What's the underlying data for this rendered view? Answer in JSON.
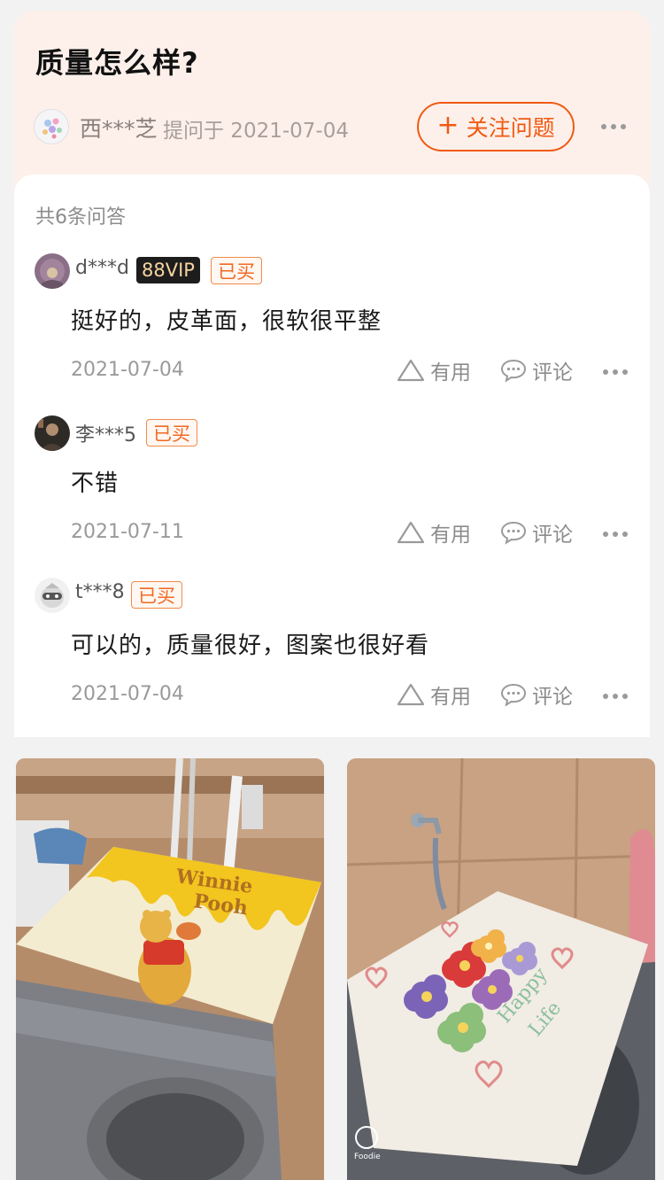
{
  "question": {
    "title": "质量怎么样?",
    "asker_name": "西***芝",
    "asked_at": "提问于 2021-07-04",
    "follow_button": {
      "icon": "plus-icon",
      "label": "关注问题"
    },
    "more_icon": "more-dots-icon"
  },
  "answers_section": {
    "count_text": "共6条问答",
    "answers": [
      {
        "user": "d***d",
        "vip_badge": "88VIP",
        "bought_badge": "已买",
        "text": "挺好的，皮革面，很软很平整",
        "date": "2021-07-04",
        "useful_label": "有用",
        "comment_label": "评论"
      },
      {
        "user": "李***5",
        "bought_badge": "已买",
        "text": "不错",
        "date": "2021-07-11",
        "useful_label": "有用",
        "comment_label": "评论"
      },
      {
        "user": "t***8",
        "bought_badge": "已买",
        "text": "可以的，质量很好，图案也很好看",
        "date": "2021-07-04",
        "useful_label": "有用",
        "comment_label": "评论"
      }
    ]
  },
  "photos": [
    {
      "name": "photo-winnie-pooh-cover",
      "caption": "Winnie the Pooh"
    },
    {
      "name": "photo-happy-life-cover",
      "caption": "Happy Life",
      "watermark": "Foodie"
    }
  ],
  "colors": {
    "accent": "#f05a13",
    "header_bg": "#fdf0ea",
    "page_bg": "#f2f2f2",
    "vip_badge_bg": "#1d1d1d",
    "vip_badge_text": "#f6d4a1"
  }
}
